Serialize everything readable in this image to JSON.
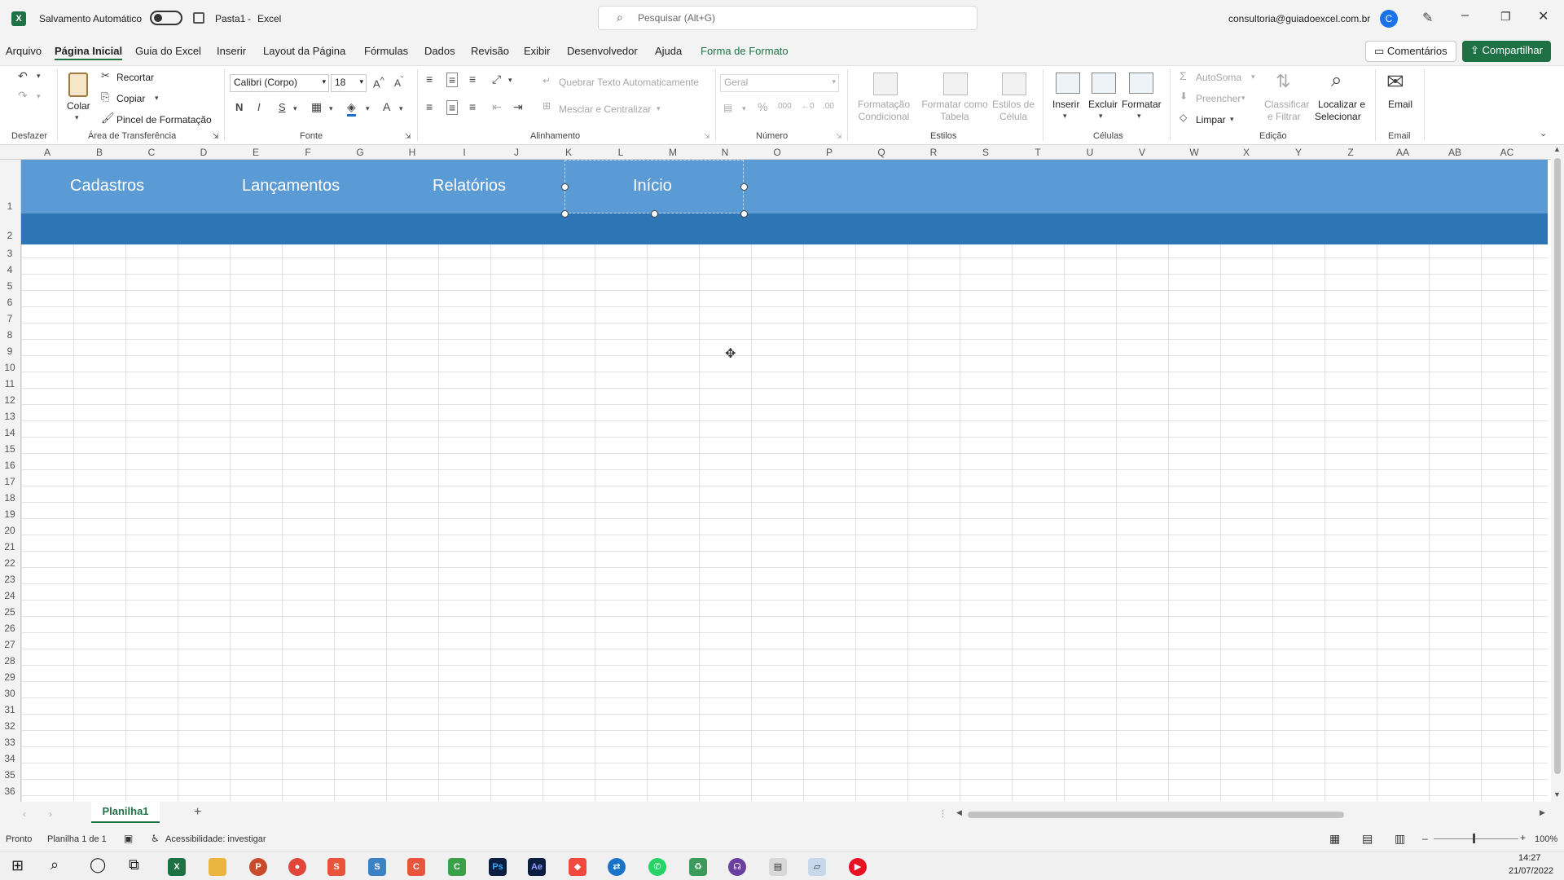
{
  "titlebar": {
    "autosave_label": "Salvamento Automático",
    "file_name": "Pasta1",
    "app_name": "Excel",
    "separator": "-",
    "search_placeholder": "Pesquisar (Alt+G)",
    "account": "consultoria@guiadoexcel.com.br",
    "avatar_initial": "C"
  },
  "menu": {
    "tabs": [
      "Arquivo",
      "Página Inicial",
      "Guia do Excel",
      "Inserir",
      "Layout da Página",
      "Fórmulas",
      "Dados",
      "Revisão",
      "Exibir",
      "Desenvolvedor",
      "Ajuda",
      "Forma de Formato"
    ],
    "comments_label": "Comentários",
    "share_label": "Compartilhar"
  },
  "ribbon": {
    "undo_group": "Desfazer",
    "clipboard": {
      "paste": "Colar",
      "cut": "Recortar",
      "copy": "Copiar",
      "format_painter": "Pincel de Formatação",
      "group": "Área de Transferência"
    },
    "font": {
      "family": "Calibri (Corpo)",
      "size": "18",
      "bold": "N",
      "italic": "I",
      "underline": "S",
      "group": "Fonte"
    },
    "alignment": {
      "wrap": "Quebrar Texto Automaticamente",
      "merge": "Mesclar e Centralizar",
      "group": "Alinhamento"
    },
    "number": {
      "format": "Geral",
      "group": "Número"
    },
    "styles": {
      "conditional_1": "Formatação",
      "conditional_2": "Condicional",
      "table_1": "Formatar como",
      "table_2": "Tabela",
      "cell_1": "Estilos de",
      "cell_2": "Célula",
      "group": "Estilos"
    },
    "cells": {
      "insert": "Inserir",
      "delete": "Excluir",
      "format": "Formatar",
      "group": "Células"
    },
    "editing": {
      "autosum": "AutoSoma",
      "fill": "Preencher",
      "clear": "Limpar",
      "sort_1": "Classificar",
      "sort_2": "e Filtrar",
      "find_1": "Localizar e",
      "find_2": "Selecionar",
      "group": "Edição"
    },
    "email": {
      "label": "Email",
      "group": "Email"
    }
  },
  "grid": {
    "columns": [
      "A",
      "B",
      "C",
      "D",
      "E",
      "F",
      "G",
      "H",
      "I",
      "J",
      "K",
      "L",
      "M",
      "N",
      "O",
      "P",
      "Q",
      "R",
      "S",
      "T",
      "U",
      "V",
      "W",
      "X",
      "Y",
      "Z",
      "AA",
      "AB",
      "AC"
    ],
    "rows": [
      "1",
      "2",
      "3",
      "4",
      "5",
      "6",
      "7",
      "8",
      "9",
      "10",
      "11",
      "12",
      "13",
      "14",
      "15",
      "16",
      "17",
      "18",
      "19",
      "20",
      "21",
      "22",
      "23",
      "24",
      "25",
      "26",
      "27",
      "28",
      "29",
      "30",
      "31",
      "32",
      "33",
      "34",
      "35",
      "36"
    ]
  },
  "banner": {
    "buttons": [
      "Cadastros",
      "Lançamentos",
      "Relatórios",
      "Início"
    ],
    "top_color": "#5b9bd5",
    "bottom_color": "#2e75b6"
  },
  "sheets": {
    "active": "Planilha1",
    "add": "+"
  },
  "status": {
    "ready": "Pronto",
    "sheet_info": "Planilha 1 de 1",
    "accessibility": "Acessibilidade: investigar",
    "zoom": "100%"
  },
  "taskbar": {
    "time": "14:27",
    "date": "21/07/2022"
  },
  "colors": {
    "accent": "#217346",
    "share_bg": "#1e7145"
  }
}
